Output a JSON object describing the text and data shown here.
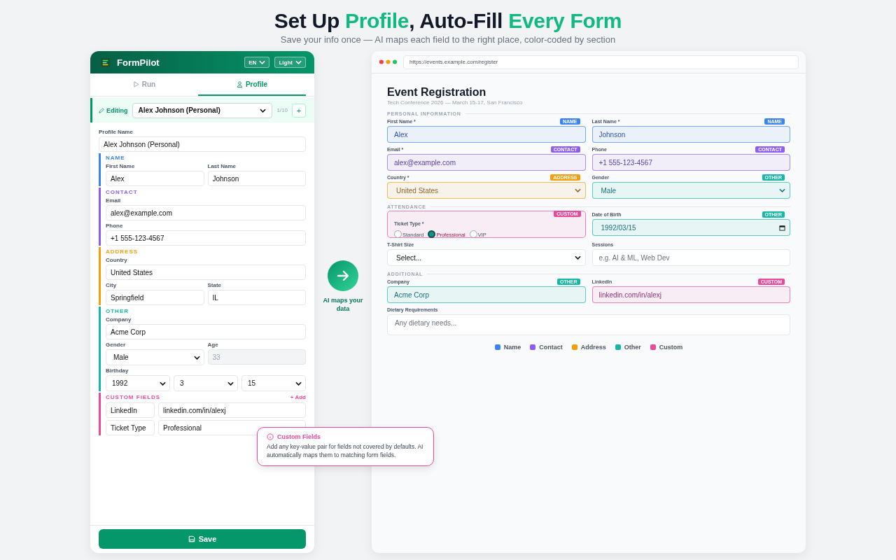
{
  "heading": {
    "parts": [
      {
        "text": "Set Up ",
        "accent": false
      },
      {
        "text": "Profile",
        "accent": true
      },
      {
        "text": ", Auto-Fill ",
        "accent": false
      },
      {
        "text": "Every Form",
        "accent": true
      }
    ],
    "subtitle": "Save your info once — AI maps each field to the right place, color-coded by section"
  },
  "extension": {
    "app_name": "FormPilot",
    "language": "EN",
    "theme": "Light",
    "tabs": [
      {
        "label": "Run",
        "kind": "run",
        "selected": false
      },
      {
        "label": "Profile",
        "kind": "profile",
        "selected": true
      }
    ],
    "editing": {
      "label": "Editing",
      "profile": "Alex Johnson (Personal)",
      "count": "1/10",
      "add": "+"
    },
    "profile_name": {
      "label": "Profile Name",
      "value": "Alex Johnson (Personal)"
    },
    "sections": [
      {
        "title": "NAME",
        "color": "#3b82f6",
        "kind": "fields",
        "rows": [
          [
            {
              "label": "First Name",
              "value": "Alex",
              "kind": "text"
            },
            {
              "label": "Last Name",
              "value": "Johnson",
              "kind": "text"
            }
          ]
        ]
      },
      {
        "title": "CONTACT",
        "color": "#8b5cf6",
        "kind": "fields",
        "rows": [
          [
            {
              "label": "Email",
              "value": "alex@example.com",
              "kind": "text"
            }
          ],
          [
            {
              "label": "Phone",
              "value": "+1 555-123-4567",
              "kind": "text"
            }
          ]
        ]
      },
      {
        "title": "ADDRESS",
        "color": "#f59e0b",
        "kind": "fields",
        "rows": [
          [
            {
              "label": "Country",
              "value": "United States",
              "kind": "text"
            }
          ],
          [
            {
              "label": "City",
              "value": "Springfield",
              "kind": "text"
            },
            {
              "label": "State",
              "value": "IL",
              "kind": "text"
            }
          ]
        ]
      },
      {
        "title": "OTHER",
        "color": "#14b8a6",
        "kind": "fields",
        "rows": [
          [
            {
              "label": "Company",
              "value": "Acme Corp",
              "kind": "text"
            }
          ],
          [
            {
              "label": "Gender",
              "value": "Male",
              "kind": "select"
            },
            {
              "label": "Age",
              "value": "33",
              "kind": "readonly"
            }
          ],
          [
            {
              "label": "Birthday",
              "values": [
                "1992",
                "3",
                "15"
              ],
              "kind": "date_parts"
            }
          ]
        ]
      },
      {
        "title": "CUSTOM FIELDS",
        "color": "#ec4899",
        "kind": "pairs",
        "add": "+ Add",
        "pairs": [
          {
            "key": "LinkedIn",
            "value": "linkedin.com/in/alexj"
          },
          {
            "key": "Ticket Type",
            "value": "Professional"
          }
        ]
      }
    ],
    "save_button": "Save"
  },
  "tooltip": {
    "title": "Custom Fields",
    "body": "Add any key-value pair for fields not covered by defaults. AI automatically maps them to matching form fields."
  },
  "arrow_caption": "AI maps your data",
  "browser": {
    "url": "https://events.example.com/register",
    "title": "Event Registration",
    "subtitle": "Tech Conference 2026 — March 15-17, San Francisco",
    "sections": [
      {
        "title": "PERSONAL INFORMATION",
        "rows": [
          [
            {
              "label": "First Name *",
              "tag": "NAME",
              "color": "#3b82f6",
              "kind": "text",
              "value": "Alex"
            },
            {
              "label": "Last Name *",
              "tag": "NAME",
              "color": "#3b82f6",
              "kind": "text",
              "value": "Johnson"
            }
          ],
          [
            {
              "label": "Email *",
              "tag": "CONTACT",
              "color": "#8b5cf6",
              "kind": "text",
              "value": "alex@example.com"
            },
            {
              "label": "Phone",
              "tag": "CONTACT",
              "color": "#8b5cf6",
              "kind": "text",
              "value": "+1 555-123-4567"
            }
          ],
          [
            {
              "label": "Country *",
              "tag": "ADDRESS",
              "color": "#f59e0b",
              "kind": "select",
              "value": "United States"
            },
            {
              "label": "Gender",
              "tag": "OTHER",
              "color": "#14b8a6",
              "kind": "select",
              "value": "Male"
            }
          ]
        ]
      },
      {
        "title": "ATTENDANCE",
        "rows": [
          [
            {
              "label": "Ticket Type *",
              "tag": "CUSTOM",
              "color": "#ec4899",
              "kind": "radio",
              "options": [
                {
                  "label": "Standard",
                  "selected": false
                },
                {
                  "label": "Professional",
                  "selected": true
                },
                {
                  "label": "VIP",
                  "selected": false
                }
              ]
            },
            {
              "label": "Date of Birth",
              "tag": "OTHER",
              "color": "#14b8a6",
              "kind": "date",
              "value": "1992/03/15"
            }
          ],
          [
            {
              "label": "T-Shirt Size",
              "kind": "select",
              "value": "Select..."
            },
            {
              "label": "Sessions",
              "kind": "text",
              "placeholder": "e.g. AI & ML, Web Dev"
            }
          ]
        ]
      },
      {
        "title": "ADDITIONAL",
        "rows": [
          [
            {
              "label": "Company",
              "tag": "OTHER",
              "color": "#14b8a6",
              "kind": "text",
              "value": "Acme Corp"
            },
            {
              "label": "LinkedIn",
              "tag": "CUSTOM",
              "color": "#ec4899",
              "kind": "text",
              "value": "linkedin.com/in/alexj"
            }
          ],
          [
            {
              "label": "Dietary Requirements",
              "kind": "textarea",
              "placeholder": "Any dietary needs..."
            }
          ]
        ]
      }
    ],
    "legend": [
      {
        "label": "Name",
        "color": "#3b82f6"
      },
      {
        "label": "Contact",
        "color": "#8b5cf6"
      },
      {
        "label": "Address",
        "color": "#f59e0b"
      },
      {
        "label": "Other",
        "color": "#14b8a6"
      },
      {
        "label": "Custom",
        "color": "#ec4899"
      }
    ]
  }
}
